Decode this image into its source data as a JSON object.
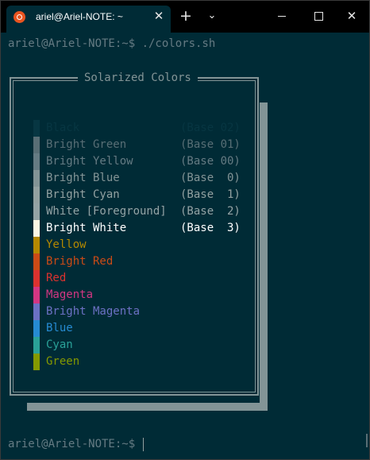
{
  "window": {
    "tab_title": "ariel@Ariel-NOTE: ~",
    "tab_icon": "ubuntu-logo-icon",
    "tab_close": "✕",
    "new_tab": "+",
    "dropdown": "⌄",
    "close_glyph": "✕"
  },
  "terminal": {
    "prompt1": "ariel@Ariel-NOTE:~$ ./colors.sh",
    "prompt2": "ariel@Ariel-NOTE:~$ ",
    "box_title": "Solarized Colors"
  },
  "colors": [
    {
      "name": "Black",
      "base": "(Base 02)",
      "color": "#073642"
    },
    {
      "name": "Bright Green",
      "base": "(Base 01)",
      "color": "#586e75"
    },
    {
      "name": "Bright Yellow",
      "base": "(Base 00)",
      "color": "#657b83"
    },
    {
      "name": "Bright Blue",
      "base": "(Base  0)",
      "color": "#839496"
    },
    {
      "name": "Bright Cyan",
      "base": "(Base  1)",
      "color": "#93a1a1"
    },
    {
      "name": "White [Foreground]",
      "base": "(Base  2)",
      "color": "#94a3a5"
    },
    {
      "name": "Bright White",
      "base": "(Base  3)",
      "color": "#fdf6e3"
    },
    {
      "name": "Yellow",
      "base": "",
      "color": "#b58900"
    },
    {
      "name": "Bright Red",
      "base": "",
      "color": "#cb4b16"
    },
    {
      "name": "Red",
      "base": "",
      "color": "#dc322f"
    },
    {
      "name": "Magenta",
      "base": "",
      "color": "#d33682"
    },
    {
      "name": "Bright Magenta",
      "base": "",
      "color": "#6c71c4"
    },
    {
      "name": "Blue",
      "base": "",
      "color": "#268bd2"
    },
    {
      "name": "Cyan",
      "base": "",
      "color": "#2aa198"
    },
    {
      "name": "Green",
      "base": "",
      "color": "#859900"
    }
  ]
}
